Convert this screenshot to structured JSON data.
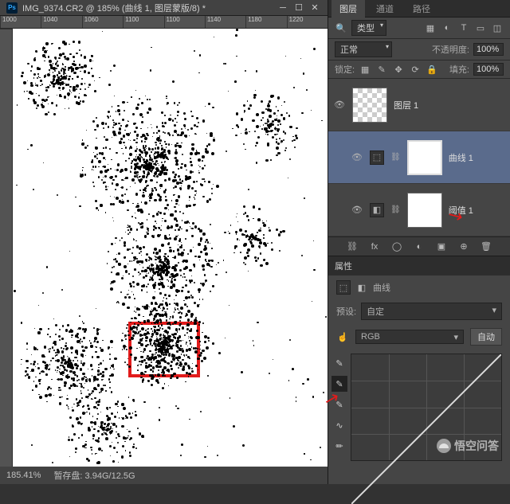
{
  "titlebar": {
    "app_badge": "Ps",
    "title": "IMG_9374.CR2 @ 185% (曲线 1, 图层蒙版/8) *"
  },
  "ruler_h": [
    "1000",
    "1040",
    "1060",
    "1100",
    "1100",
    "1140",
    "1180",
    "1220"
  ],
  "ruler_v": [
    "",
    "",
    "",
    "",
    "",
    "",
    "",
    "",
    "",
    "",
    "",
    "",
    ""
  ],
  "statusbar": {
    "zoom": "185.41%",
    "scratch": "暂存盘: 3.94G/12.5G"
  },
  "panels": {
    "tabs": [
      "图层",
      "通道",
      "路径"
    ],
    "filter": {
      "kind_label": "类型"
    },
    "blend": {
      "mode": "正常",
      "opacity_label": "不透明度:",
      "opacity_value": "100%",
      "lock_label": "锁定:",
      "fill_label": "填充:",
      "fill_value": "100%"
    },
    "layers": [
      {
        "name": "图层 1",
        "type": "raster",
        "selected": false,
        "indent": false
      },
      {
        "name": "曲线 1",
        "type": "curves",
        "selected": true,
        "indent": true
      },
      {
        "name": "阈值 1",
        "type": "threshold",
        "selected": false,
        "indent": true
      }
    ]
  },
  "properties": {
    "panel_title": "属性",
    "adj_title": "曲线",
    "preset_label": "预设:",
    "preset_value": "自定",
    "channel": "RGB",
    "auto_label": "自动"
  },
  "watermark": "悟空问答",
  "colors": {
    "red": "#e21b1b"
  }
}
